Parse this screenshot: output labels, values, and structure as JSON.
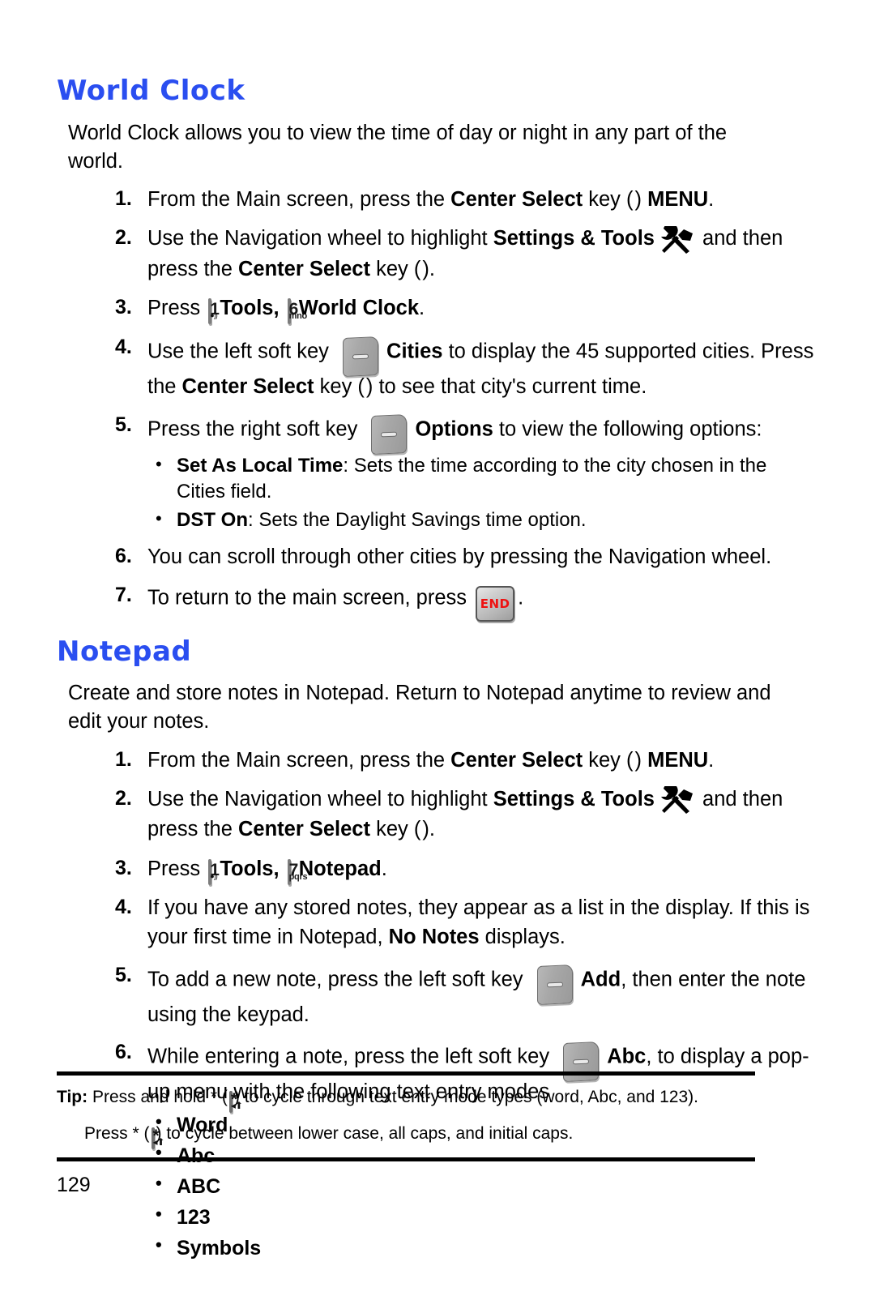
{
  "page": {
    "number": "129"
  },
  "sections": [
    {
      "id": "world-clock",
      "title": "World Clock",
      "title_color": "#2a4ef0",
      "intro": "World Clock allows you to view the time of day or night in any part of the world.",
      "steps": [
        {
          "num": "1.",
          "parts": [
            {
              "t": "text",
              "v": "From the Main screen, press the "
            },
            {
              "t": "bold",
              "v": "Center Select"
            },
            {
              "t": "text",
              "v": " key ("
            },
            {
              "t": "icon",
              "v": "center-select-key"
            },
            {
              "t": "text",
              "v": ") "
            },
            {
              "t": "bold",
              "v": "MENU"
            },
            {
              "t": "text",
              "v": "."
            }
          ]
        },
        {
          "num": "2.",
          "parts": [
            {
              "t": "text",
              "v": "Use the Navigation wheel to highlight "
            },
            {
              "t": "bold",
              "v": "Settings & Tools"
            },
            {
              "t": "icon",
              "v": "settings-tools-icon"
            },
            {
              "t": "text",
              "v": " and then press the "
            },
            {
              "t": "bold",
              "v": "Center Select"
            },
            {
              "t": "text",
              "v": " key ("
            },
            {
              "t": "icon",
              "v": "center-select-key"
            },
            {
              "t": "text",
              "v": ")."
            }
          ]
        },
        {
          "num": "3.",
          "parts": [
            {
              "t": "text",
              "v": "Press "
            },
            {
              "t": "icon",
              "v": "key-1"
            },
            {
              "t": "bold",
              "v": " Tools, "
            },
            {
              "t": "icon",
              "v": "key-6-mno"
            },
            {
              "t": "bold",
              "v": " World Clock"
            },
            {
              "t": "text",
              "v": "."
            }
          ]
        },
        {
          "num": "4.",
          "parts": [
            {
              "t": "text",
              "v": "Use the left soft key "
            },
            {
              "t": "icon",
              "v": "left-soft-key"
            },
            {
              "t": "bold",
              "v": "Cities"
            },
            {
              "t": "text",
              "v": " to display the 45 supported cities. Press the "
            },
            {
              "t": "bold",
              "v": "Center Select"
            },
            {
              "t": "text",
              "v": " key ("
            },
            {
              "t": "icon",
              "v": "center-select-key"
            },
            {
              "t": "text",
              "v": ") to see that city's current time."
            }
          ]
        },
        {
          "num": "5.",
          "parts": [
            {
              "t": "text",
              "v": "Press the right soft key "
            },
            {
              "t": "icon",
              "v": "right-soft-key"
            },
            {
              "t": "bold",
              "v": "Options"
            },
            {
              "t": "text",
              "v": " to view the following options:"
            }
          ],
          "sublist": [
            {
              "bold": "Set As Local Time",
              "rest": ": Sets the time according to the city chosen in the Cities field."
            },
            {
              "bold": "DST On",
              "rest": ": Sets the Daylight Savings time option."
            }
          ]
        },
        {
          "num": "6.",
          "parts": [
            {
              "t": "text",
              "v": "You can scroll through other cities by pressing the Navigation wheel."
            }
          ]
        },
        {
          "num": "7.",
          "parts": [
            {
              "t": "text",
              "v": "To return to the main screen, press "
            },
            {
              "t": "icon",
              "v": "end-key"
            },
            {
              "t": "text",
              "v": "."
            }
          ]
        }
      ]
    },
    {
      "id": "notepad",
      "title": "Notepad",
      "title_color": "#2a4ef0",
      "intro": "Create and store notes in Notepad. Return to Notepad anytime to review and edit your notes.",
      "steps": [
        {
          "num": "1.",
          "parts": [
            {
              "t": "text",
              "v": "From the Main screen, press the "
            },
            {
              "t": "bold",
              "v": "Center Select"
            },
            {
              "t": "text",
              "v": " key ("
            },
            {
              "t": "icon",
              "v": "center-select-key"
            },
            {
              "t": "text",
              "v": ") "
            },
            {
              "t": "bold",
              "v": "MENU"
            },
            {
              "t": "text",
              "v": "."
            }
          ]
        },
        {
          "num": "2.",
          "parts": [
            {
              "t": "text",
              "v": "Use the Navigation wheel to highlight "
            },
            {
              "t": "bold",
              "v": "Settings & Tools"
            },
            {
              "t": "icon",
              "v": "settings-tools-icon"
            },
            {
              "t": "text",
              "v": " and then press the "
            },
            {
              "t": "bold",
              "v": "Center Select"
            },
            {
              "t": "text",
              "v": " key ("
            },
            {
              "t": "icon",
              "v": "center-select-key"
            },
            {
              "t": "text",
              "v": ")."
            }
          ]
        },
        {
          "num": "3.",
          "parts": [
            {
              "t": "text",
              "v": "Press "
            },
            {
              "t": "icon",
              "v": "key-1"
            },
            {
              "t": "bold",
              "v": " Tools, "
            },
            {
              "t": "icon",
              "v": "key-7-pqrs"
            },
            {
              "t": "bold",
              "v": " Notepad"
            },
            {
              "t": "text",
              "v": "."
            }
          ]
        },
        {
          "num": "4.",
          "parts": [
            {
              "t": "text",
              "v": "If you have any stored notes, they appear as a list in the display. If this is your first time in Notepad, "
            },
            {
              "t": "bold",
              "v": "No Notes"
            },
            {
              "t": "text",
              "v": " displays."
            }
          ]
        },
        {
          "num": "5.",
          "parts": [
            {
              "t": "text",
              "v": "To add a new note, press the left soft key "
            },
            {
              "t": "icon",
              "v": "left-soft-key"
            },
            {
              "t": "bold",
              "v": "Add"
            },
            {
              "t": "text",
              "v": ", then enter the note using the keypad."
            }
          ]
        },
        {
          "num": "6.",
          "parts": [
            {
              "t": "text",
              "v": "While entering a note, press the left soft key "
            },
            {
              "t": "icon",
              "v": "left-soft-key"
            },
            {
              "t": "bold",
              "v": "Abc"
            },
            {
              "t": "text",
              "v": ", to display a pop-up menu with the following text entry modes"
            }
          ],
          "modelist": [
            "Word",
            "Abc",
            "ABC",
            "123",
            "Symbols"
          ]
        }
      ]
    }
  ],
  "tip": {
    "label": "Tip:",
    "line1_before": " Press and hold * (",
    "line1_after": ") to cycle through text entry mode types (word, Abc, and 123).",
    "line2_before": "Press * (",
    "line2_after": ") to cycle between lower case, all caps, and initial caps.",
    "star_key_glyph": "*",
    "star_key_sub": "shift-arrow"
  },
  "icons": {
    "center-select-key": "round-gray-button",
    "settings-tools-icon": "hammer-wrench-crossed",
    "left-soft-key": "soft-key-slab",
    "right-soft-key": "soft-key-slab",
    "end-key": "END",
    "key-1": {
      "num": "1",
      "sub": "voicemail"
    },
    "key-6-mno": {
      "num": "6",
      "sub": "mno"
    },
    "key-7-pqrs": {
      "num": "7",
      "sub": "pqrs"
    }
  }
}
